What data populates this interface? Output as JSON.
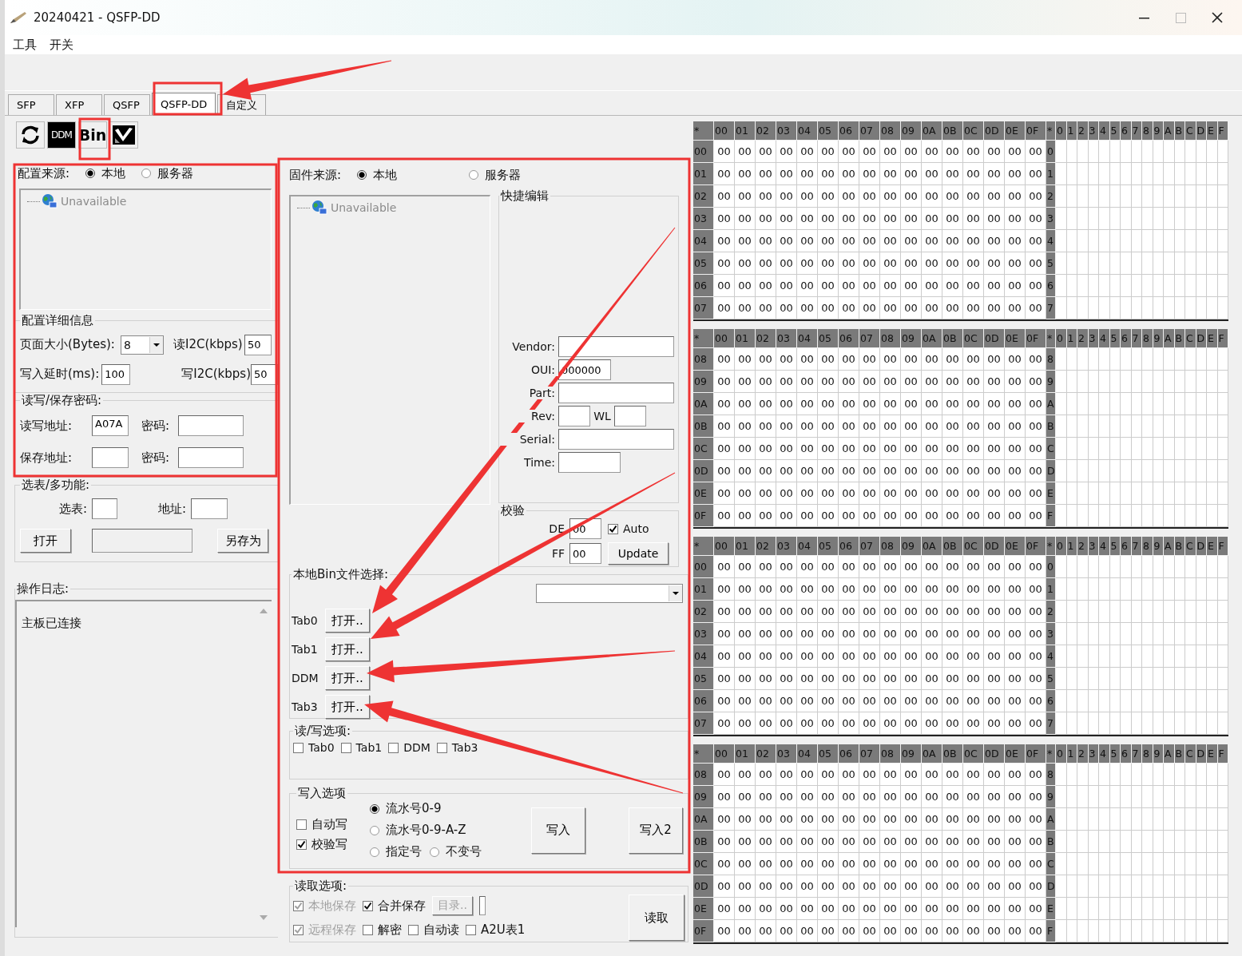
{
  "window": {
    "title": "20240421  - QSFP-DD"
  },
  "menu": [
    "工具",
    "开关"
  ],
  "tabs": [
    {
      "label": "SFP",
      "selected": false
    },
    {
      "label": "XFP",
      "selected": false
    },
    {
      "label": "QSFP",
      "selected": false
    },
    {
      "label": "QSFP-DD",
      "selected": true
    },
    {
      "label": "自定义",
      "selected": false
    }
  ],
  "toolbar": [
    {
      "kind": "refresh"
    },
    {
      "kind": "dark-label",
      "label": "DDM"
    },
    {
      "kind": "label",
      "label": "Bin"
    },
    {
      "kind": "tool"
    }
  ],
  "config": {
    "source_label": "配置来源:",
    "sources": [
      {
        "label": "本地",
        "selected": true
      },
      {
        "label": "服务器",
        "selected": false
      }
    ],
    "tree_item": "Unavailable",
    "details_title": "配置详细信息",
    "page_size_label": "页面大小(Bytes):",
    "page_size": "8",
    "read_i2c_label": "读I2C(kbps)",
    "read_i2c": "50",
    "write_delay_label": "写入延时(ms):",
    "write_delay": "100",
    "write_i2c_label": "写I2C(kbps)",
    "write_i2c": "50",
    "password_title": "读写/保存密码:",
    "rw_addr_label": "读写地址:",
    "rw_addr": "A07A",
    "rw_pwd_label": "密码:",
    "save_addr_label": "保存地址:",
    "save_pwd_label": "密码:"
  },
  "multi": {
    "title": "选表/多功能:",
    "table_label": "选表:",
    "addr_label": "地址:",
    "open_button": "打开",
    "save_as_button": "另存为"
  },
  "log": {
    "title": "操作日志:",
    "lines": [
      "主板已连接"
    ]
  },
  "firmware": {
    "source_label": "固件来源:",
    "sources": [
      {
        "label": "本地",
        "selected": true
      },
      {
        "label": "服务器",
        "selected": false
      }
    ],
    "tree_item": "Unavailable"
  },
  "quick_edit": {
    "title": "快捷编辑",
    "vendor_label": "Vendor:",
    "oui_label": "OUI:",
    "oui": "000000",
    "part_label": "Part:",
    "rev_label": "Rev:",
    "wl_label": "WL",
    "serial_label": "Serial:",
    "time_label": "Time:"
  },
  "checksum": {
    "title": "校验",
    "de_label": "DE",
    "de": "00",
    "ff_label": "FF",
    "ff": "00",
    "auto": {
      "label": "Auto",
      "checked": true
    },
    "update_button": "Update"
  },
  "bin_files": {
    "title": "本地Bin文件选择:",
    "rows": [
      {
        "label": "Tab0",
        "button": "打开.."
      },
      {
        "label": "Tab1",
        "button": "打开.."
      },
      {
        "label": "DDM",
        "button": "打开.."
      },
      {
        "label": "Tab3",
        "button": "打开.."
      }
    ]
  },
  "rw_options": {
    "title": "读/写选项:",
    "items": [
      {
        "label": "Tab0",
        "checked": false
      },
      {
        "label": "Tab1",
        "checked": false
      },
      {
        "label": "DDM",
        "checked": false
      },
      {
        "label": "Tab3",
        "checked": false
      }
    ]
  },
  "write_options": {
    "title": "写入选项",
    "checks": [
      {
        "label": "自动写",
        "checked": false
      },
      {
        "label": "校验写",
        "checked": true
      }
    ],
    "modes": [
      {
        "label": "流水号0-9",
        "selected": true
      },
      {
        "label": "流水号0-9-A-Z",
        "selected": false
      },
      {
        "label": "指定号",
        "selected": false
      },
      {
        "label": "不变号",
        "selected": false
      }
    ],
    "buttons": [
      "写入",
      "写入2"
    ]
  },
  "read_options": {
    "title": "读取选项:",
    "checks": [
      {
        "label": "本地保存",
        "checked": true,
        "disabled": true
      },
      {
        "label": "合并保存",
        "checked": true,
        "disabled": false
      },
      {
        "label": "远程保存",
        "checked": true,
        "disabled": true
      },
      {
        "label": "解密",
        "checked": false,
        "disabled": false
      },
      {
        "label": "自动读",
        "checked": false,
        "disabled": false
      },
      {
        "label": "A2U表1",
        "checked": false,
        "disabled": false
      }
    ],
    "dir_button": "目录..",
    "read_button": "读取"
  },
  "hex_blocks": [
    {
      "header": [
        "*",
        "00",
        "01",
        "02",
        "03",
        "04",
        "05",
        "06",
        "07",
        "08",
        "09",
        "0A",
        "0B",
        "0C",
        "0D",
        "0E",
        "0F",
        "*",
        "0",
        "1",
        "2",
        "3",
        "4",
        "5",
        "6",
        "7",
        "8",
        "9",
        "A",
        "B",
        "C",
        "D",
        "E",
        "F"
      ],
      "rows": [
        {
          "label": "00",
          "ascii_label": "0",
          "cells": [
            "00",
            "00",
            "00",
            "00",
            "00",
            "00",
            "00",
            "00",
            "00",
            "00",
            "00",
            "00",
            "00",
            "00",
            "00",
            "00"
          ]
        },
        {
          "label": "01",
          "ascii_label": "1",
          "cells": [
            "00",
            "00",
            "00",
            "00",
            "00",
            "00",
            "00",
            "00",
            "00",
            "00",
            "00",
            "00",
            "00",
            "00",
            "00",
            "00"
          ]
        },
        {
          "label": "02",
          "ascii_label": "2",
          "cells": [
            "00",
            "00",
            "00",
            "00",
            "00",
            "00",
            "00",
            "00",
            "00",
            "00",
            "00",
            "00",
            "00",
            "00",
            "00",
            "00"
          ]
        },
        {
          "label": "03",
          "ascii_label": "3",
          "cells": [
            "00",
            "00",
            "00",
            "00",
            "00",
            "00",
            "00",
            "00",
            "00",
            "00",
            "00",
            "00",
            "00",
            "00",
            "00",
            "00"
          ]
        },
        {
          "label": "04",
          "ascii_label": "4",
          "cells": [
            "00",
            "00",
            "00",
            "00",
            "00",
            "00",
            "00",
            "00",
            "00",
            "00",
            "00",
            "00",
            "00",
            "00",
            "00",
            "00"
          ]
        },
        {
          "label": "05",
          "ascii_label": "5",
          "cells": [
            "00",
            "00",
            "00",
            "00",
            "00",
            "00",
            "00",
            "00",
            "00",
            "00",
            "00",
            "00",
            "00",
            "00",
            "00",
            "00"
          ]
        },
        {
          "label": "06",
          "ascii_label": "6",
          "cells": [
            "00",
            "00",
            "00",
            "00",
            "00",
            "00",
            "00",
            "00",
            "00",
            "00",
            "00",
            "00",
            "00",
            "00",
            "00",
            "00"
          ]
        },
        {
          "label": "07",
          "ascii_label": "7",
          "cells": [
            "00",
            "00",
            "00",
            "00",
            "00",
            "00",
            "00",
            "00",
            "00",
            "00",
            "00",
            "00",
            "00",
            "00",
            "00",
            "00"
          ]
        }
      ]
    },
    {
      "header": [
        "*",
        "00",
        "01",
        "02",
        "03",
        "04",
        "05",
        "06",
        "07",
        "08",
        "09",
        "0A",
        "0B",
        "0C",
        "0D",
        "0E",
        "0F",
        "*",
        "0",
        "1",
        "2",
        "3",
        "4",
        "5",
        "6",
        "7",
        "8",
        "9",
        "A",
        "B",
        "C",
        "D",
        "E",
        "F"
      ],
      "rows": [
        {
          "label": "08",
          "ascii_label": "8",
          "cells": [
            "00",
            "00",
            "00",
            "00",
            "00",
            "00",
            "00",
            "00",
            "00",
            "00",
            "00",
            "00",
            "00",
            "00",
            "00",
            "00"
          ]
        },
        {
          "label": "09",
          "ascii_label": "9",
          "cells": [
            "00",
            "00",
            "00",
            "00",
            "00",
            "00",
            "00",
            "00",
            "00",
            "00",
            "00",
            "00",
            "00",
            "00",
            "00",
            "00"
          ]
        },
        {
          "label": "0A",
          "ascii_label": "A",
          "cells": [
            "00",
            "00",
            "00",
            "00",
            "00",
            "00",
            "00",
            "00",
            "00",
            "00",
            "00",
            "00",
            "00",
            "00",
            "00",
            "00"
          ]
        },
        {
          "label": "0B",
          "ascii_label": "B",
          "cells": [
            "00",
            "00",
            "00",
            "00",
            "00",
            "00",
            "00",
            "00",
            "00",
            "00",
            "00",
            "00",
            "00",
            "00",
            "00",
            "00"
          ]
        },
        {
          "label": "0C",
          "ascii_label": "C",
          "cells": [
            "00",
            "00",
            "00",
            "00",
            "00",
            "00",
            "00",
            "00",
            "00",
            "00",
            "00",
            "00",
            "00",
            "00",
            "00",
            "00"
          ]
        },
        {
          "label": "0D",
          "ascii_label": "D",
          "cells": [
            "00",
            "00",
            "00",
            "00",
            "00",
            "00",
            "00",
            "00",
            "00",
            "00",
            "00",
            "00",
            "00",
            "00",
            "00",
            "00"
          ]
        },
        {
          "label": "0E",
          "ascii_label": "E",
          "cells": [
            "00",
            "00",
            "00",
            "00",
            "00",
            "00",
            "00",
            "00",
            "00",
            "00",
            "00",
            "00",
            "00",
            "00",
            "00",
            "00"
          ]
        },
        {
          "label": "0F",
          "ascii_label": "F",
          "cells": [
            "00",
            "00",
            "00",
            "00",
            "00",
            "00",
            "00",
            "00",
            "00",
            "00",
            "00",
            "00",
            "00",
            "00",
            "00",
            "00"
          ]
        }
      ]
    },
    {
      "header": [
        "*",
        "00",
        "01",
        "02",
        "03",
        "04",
        "05",
        "06",
        "07",
        "08",
        "09",
        "0A",
        "0B",
        "0C",
        "0D",
        "0E",
        "0F",
        "*",
        "0",
        "1",
        "2",
        "3",
        "4",
        "5",
        "6",
        "7",
        "8",
        "9",
        "A",
        "B",
        "C",
        "D",
        "E",
        "F"
      ],
      "rows": [
        {
          "label": "00",
          "ascii_label": "0",
          "cells": [
            "00",
            "00",
            "00",
            "00",
            "00",
            "00",
            "00",
            "00",
            "00",
            "00",
            "00",
            "00",
            "00",
            "00",
            "00",
            "00"
          ]
        },
        {
          "label": "01",
          "ascii_label": "1",
          "cells": [
            "00",
            "00",
            "00",
            "00",
            "00",
            "00",
            "00",
            "00",
            "00",
            "00",
            "00",
            "00",
            "00",
            "00",
            "00",
            "00"
          ]
        },
        {
          "label": "02",
          "ascii_label": "2",
          "cells": [
            "00",
            "00",
            "00",
            "00",
            "00",
            "00",
            "00",
            "00",
            "00",
            "00",
            "00",
            "00",
            "00",
            "00",
            "00",
            "00"
          ]
        },
        {
          "label": "03",
          "ascii_label": "3",
          "cells": [
            "00",
            "00",
            "00",
            "00",
            "00",
            "00",
            "00",
            "00",
            "00",
            "00",
            "00",
            "00",
            "00",
            "00",
            "00",
            "00"
          ]
        },
        {
          "label": "04",
          "ascii_label": "4",
          "cells": [
            "00",
            "00",
            "00",
            "00",
            "00",
            "00",
            "00",
            "00",
            "00",
            "00",
            "00",
            "00",
            "00",
            "00",
            "00",
            "00"
          ]
        },
        {
          "label": "05",
          "ascii_label": "5",
          "cells": [
            "00",
            "00",
            "00",
            "00",
            "00",
            "00",
            "00",
            "00",
            "00",
            "00",
            "00",
            "00",
            "00",
            "00",
            "00",
            "00"
          ]
        },
        {
          "label": "06",
          "ascii_label": "6",
          "cells": [
            "00",
            "00",
            "00",
            "00",
            "00",
            "00",
            "00",
            "00",
            "00",
            "00",
            "00",
            "00",
            "00",
            "00",
            "00",
            "00"
          ]
        },
        {
          "label": "07",
          "ascii_label": "7",
          "cells": [
            "00",
            "00",
            "00",
            "00",
            "00",
            "00",
            "00",
            "00",
            "00",
            "00",
            "00",
            "00",
            "00",
            "00",
            "00",
            "00"
          ]
        }
      ]
    },
    {
      "header": [
        "*",
        "00",
        "01",
        "02",
        "03",
        "04",
        "05",
        "06",
        "07",
        "08",
        "09",
        "0A",
        "0B",
        "0C",
        "0D",
        "0E",
        "0F",
        "*",
        "0",
        "1",
        "2",
        "3",
        "4",
        "5",
        "6",
        "7",
        "8",
        "9",
        "A",
        "B",
        "C",
        "D",
        "E",
        "F"
      ],
      "rows": [
        {
          "label": "08",
          "ascii_label": "8",
          "cells": [
            "00",
            "00",
            "00",
            "00",
            "00",
            "00",
            "00",
            "00",
            "00",
            "00",
            "00",
            "00",
            "00",
            "00",
            "00",
            "00"
          ]
        },
        {
          "label": "09",
          "ascii_label": "9",
          "cells": [
            "00",
            "00",
            "00",
            "00",
            "00",
            "00",
            "00",
            "00",
            "00",
            "00",
            "00",
            "00",
            "00",
            "00",
            "00",
            "00"
          ]
        },
        {
          "label": "0A",
          "ascii_label": "A",
          "cells": [
            "00",
            "00",
            "00",
            "00",
            "00",
            "00",
            "00",
            "00",
            "00",
            "00",
            "00",
            "00",
            "00",
            "00",
            "00",
            "00"
          ]
        },
        {
          "label": "0B",
          "ascii_label": "B",
          "cells": [
            "00",
            "00",
            "00",
            "00",
            "00",
            "00",
            "00",
            "00",
            "00",
            "00",
            "00",
            "00",
            "00",
            "00",
            "00",
            "00"
          ]
        },
        {
          "label": "0C",
          "ascii_label": "C",
          "cells": [
            "00",
            "00",
            "00",
            "00",
            "00",
            "00",
            "00",
            "00",
            "00",
            "00",
            "00",
            "00",
            "00",
            "00",
            "00",
            "00"
          ]
        },
        {
          "label": "0D",
          "ascii_label": "D",
          "cells": [
            "00",
            "00",
            "00",
            "00",
            "00",
            "00",
            "00",
            "00",
            "00",
            "00",
            "00",
            "00",
            "00",
            "00",
            "00",
            "00"
          ]
        },
        {
          "label": "0E",
          "ascii_label": "E",
          "cells": [
            "00",
            "00",
            "00",
            "00",
            "00",
            "00",
            "00",
            "00",
            "00",
            "00",
            "00",
            "00",
            "00",
            "00",
            "00",
            "00"
          ]
        },
        {
          "label": "0F",
          "ascii_label": "F",
          "cells": [
            "00",
            "00",
            "00",
            "00",
            "00",
            "00",
            "00",
            "00",
            "00",
            "00",
            "00",
            "00",
            "00",
            "00",
            "00",
            "00"
          ]
        }
      ]
    }
  ]
}
